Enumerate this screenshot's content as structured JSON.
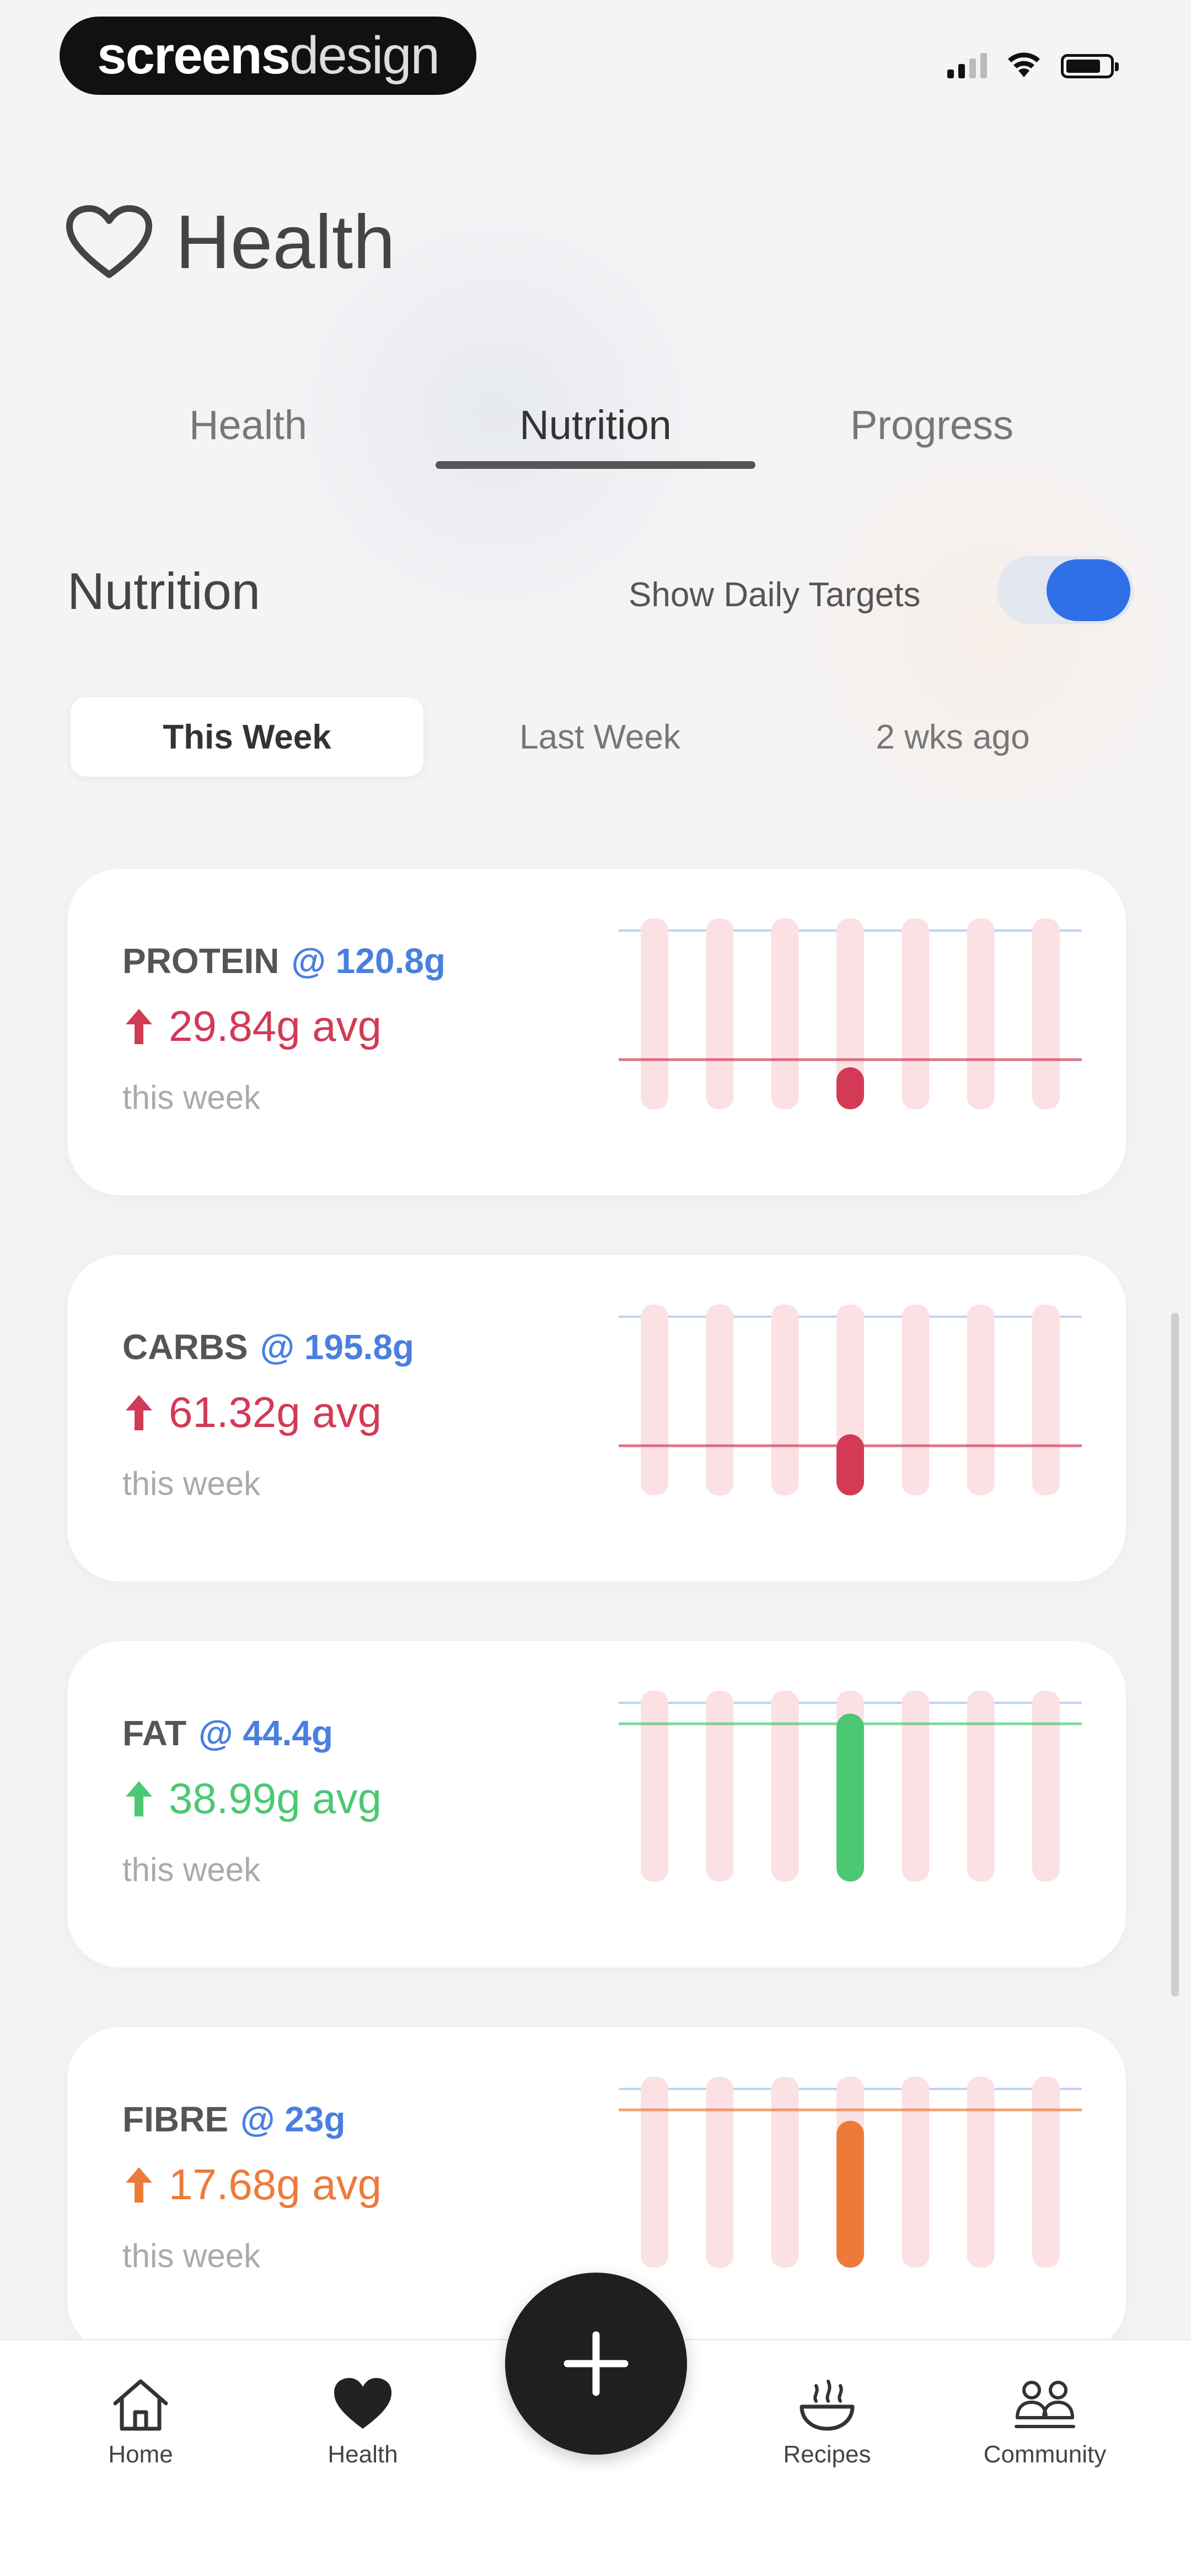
{
  "status_bar": {
    "brand_bold": "screens",
    "brand_light": "design"
  },
  "header": {
    "title": "Health",
    "icon": "heart-outline-icon"
  },
  "tabs": [
    {
      "label": "Health",
      "active": false
    },
    {
      "label": "Nutrition",
      "active": true
    },
    {
      "label": "Progress",
      "active": false
    }
  ],
  "section": {
    "title": "Nutrition",
    "toggle_label": "Show Daily Targets",
    "toggle_on": true
  },
  "periods": [
    {
      "label": "This Week",
      "active": true
    },
    {
      "label": "Last Week",
      "active": false
    },
    {
      "label": "2 wks ago",
      "active": false
    }
  ],
  "cards": [
    {
      "name": "PROTEIN",
      "target": "@ 120.8g",
      "avg": "29.84g avg",
      "period": "this week",
      "color": "#d23a55",
      "day_fraction": 0.22
    },
    {
      "name": "CARBS",
      "target": "@ 195.8g",
      "avg": "61.32g avg",
      "period": "this week",
      "color": "#d23a55",
      "day_fraction": 0.32
    },
    {
      "name": "FAT",
      "target": "@ 44.4g",
      "avg": "38.99g avg",
      "period": "this week",
      "color": "#4cc873",
      "day_fraction": 0.88
    },
    {
      "name": "FIBRE",
      "target": "@ 23g",
      "avg": "17.68g avg",
      "period": "this week",
      "color": "#ee7a3a",
      "day_fraction": 0.77
    }
  ],
  "bottom_nav": [
    {
      "label": "Home",
      "icon": "home-icon"
    },
    {
      "label": "Health",
      "icon": "heart-filled-icon"
    },
    {
      "label": "Recipes",
      "icon": "recipes-bowl-icon"
    },
    {
      "label": "Community",
      "icon": "community-people-icon"
    }
  ],
  "fab": {
    "icon": "plus-icon"
  },
  "colors": {
    "accent_blue": "#2f6fe8",
    "target_blue": "#4a7fe0",
    "bar_track": "#fbe1e4"
  }
}
